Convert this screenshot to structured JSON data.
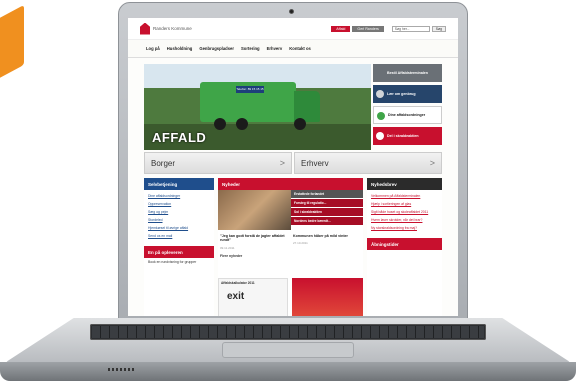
{
  "header": {
    "brand": "Randers",
    "brand_suffix": "Kommune",
    "tab_active": "Affald",
    "tab_other": "Gerl Randers",
    "search_placeholder": "Søg her...",
    "search_button": "Søg"
  },
  "nav": [
    "Log på",
    "Husholdning",
    "Genbrugspladser",
    "Sortering",
    "Erhverv",
    "Kontakt os"
  ],
  "hero": {
    "title": "AFFALD",
    "truck_text": "Telefon: 89 15 15 15"
  },
  "side_buttons": [
    {
      "label": "Bestil Affaldsterminalen",
      "icon": ""
    },
    {
      "label": "Lær om genbrug",
      "icon": "recycle-icon"
    },
    {
      "label": "Dine affaldsordninger",
      "icon": "bin-icon"
    },
    {
      "label": "Del i skraldeaktien",
      "icon": "check-icon"
    }
  ],
  "tiles": [
    {
      "label": "Borger",
      "arrow": ">"
    },
    {
      "label": "Erhverv",
      "arrow": ">"
    }
  ],
  "self_service": {
    "title": "Selvbetjening",
    "links": [
      "Dine affaldsordninger",
      "Oppreservation",
      "Sæg og pejm",
      "Stordeled",
      "Hjemkørsel til øvrige affald",
      "Send os en mail"
    ]
  },
  "experience": {
    "title": "En på opleveren",
    "text": "Book en rundvisning for grupper"
  },
  "news": {
    "title": "Nyheder",
    "items": [
      "Erstattede forlandet",
      "Forsteg til regulatio...",
      "Sol i skraldeaktien",
      "Nordens bedre bæredt..."
    ],
    "cap1": "\"Jeg kan godt forstå de jagter affaldet rundt\"",
    "date1": "09.11.2011",
    "cap2": "Kommunen håber på mild vinter",
    "date2": "27.10.2011",
    "more": "Flere nyheder",
    "promo": "Affaldskalkulator 2011",
    "promo_logo": "exit"
  },
  "newsletter": {
    "title": "Nyhedsbrev",
    "links": [
      "Velkommen på Affaldsterminalen",
      "Hjælp i sortieringen af glas",
      "Siglt både huset og skoleaffaldet 2011",
      "Hvem laver skrotder, når det brar?",
      "Ny storskraldsordning fra maj?"
    ]
  },
  "hours": {
    "title": "Åbningstider"
  },
  "colors": {
    "brand_red": "#c8102e",
    "brand_blue": "#1f4e8c",
    "navy": "#26456b"
  }
}
